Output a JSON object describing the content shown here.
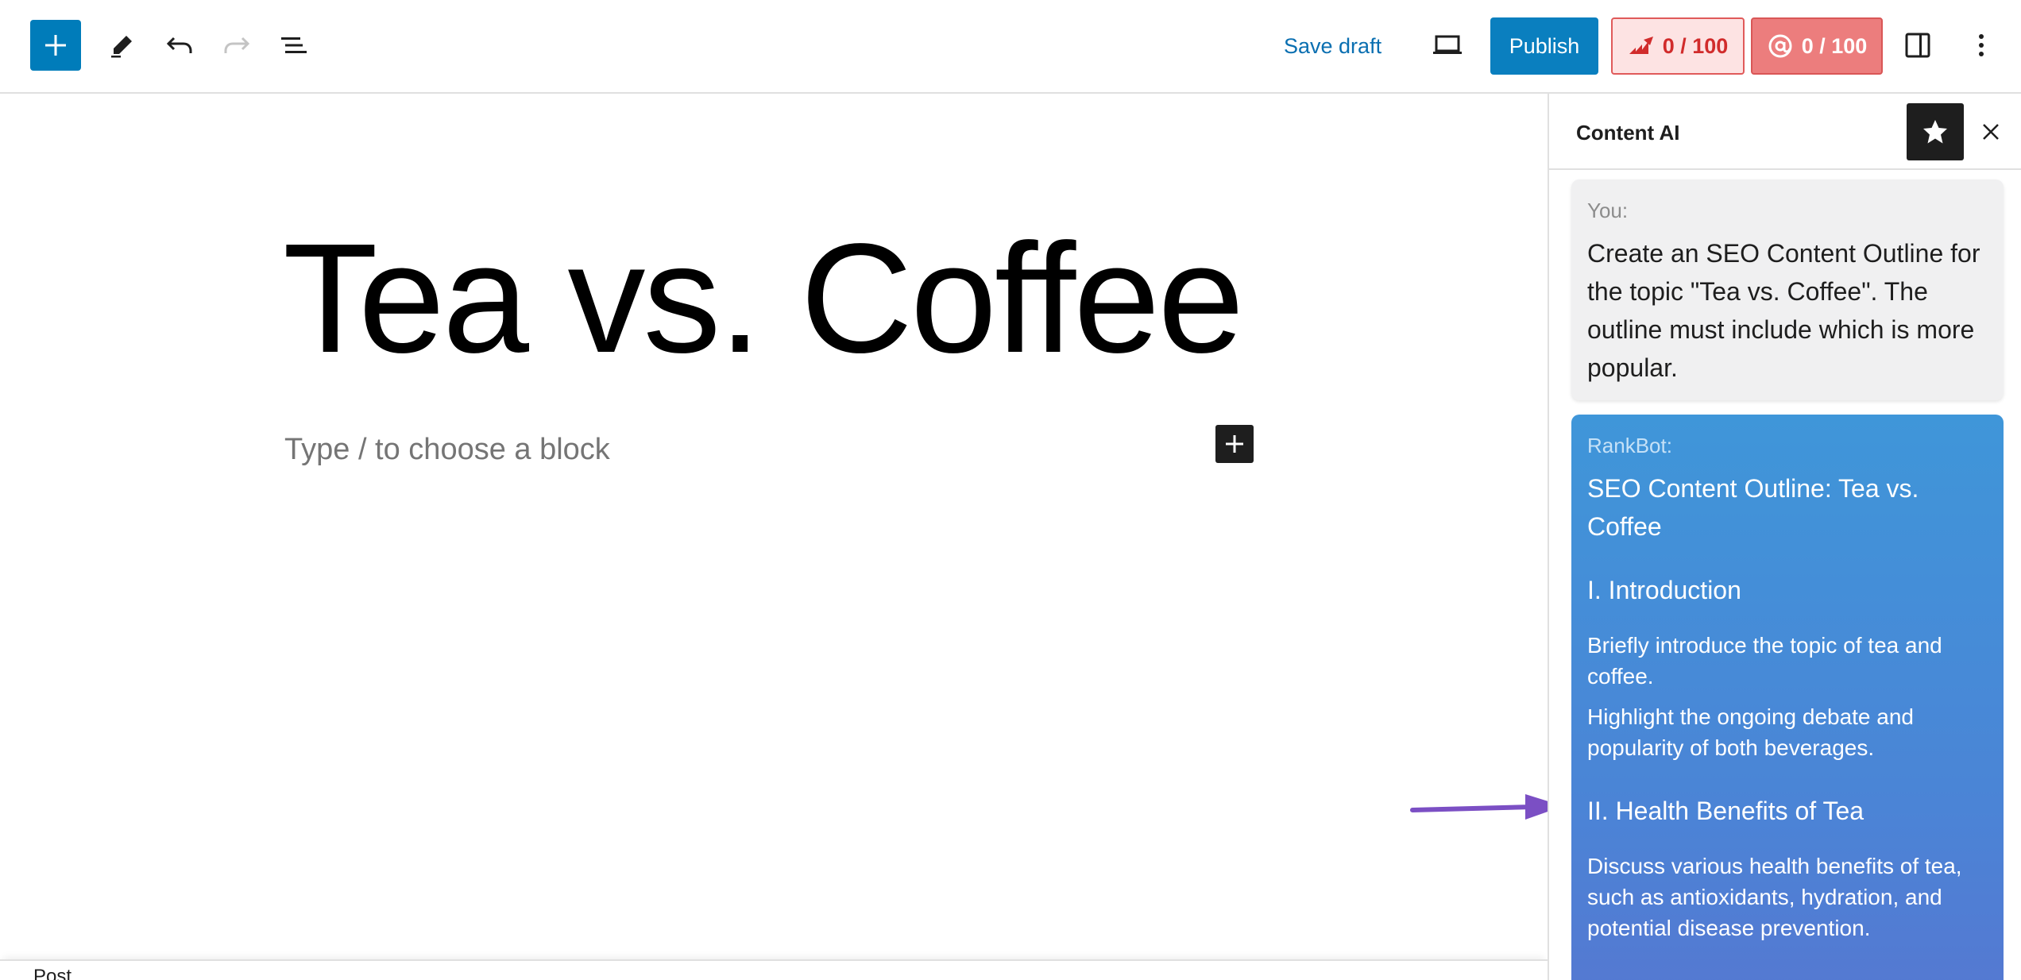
{
  "toolbar": {
    "save_draft": "Save draft",
    "publish": "Publish",
    "seo_score": "0 / 100",
    "content_score": "0 / 100"
  },
  "editor": {
    "title": "Tea vs. Coffee",
    "block_placeholder": "Type / to choose a block"
  },
  "footer": {
    "breadcrumb": "Post"
  },
  "sidebar": {
    "title": "Content AI",
    "user_message": {
      "author": "You:",
      "text": "Create an SEO Content Outline for the topic \"Tea vs. Coffee\". The outline must include which is more popular."
    },
    "bot_message": {
      "author": "RankBot:",
      "heading": "SEO Content Outline: Tea vs. Coffee",
      "section1_title": "I. Introduction",
      "section1_p1": "Briefly introduce the topic of tea and coffee.",
      "section1_p2": "Highlight the ongoing debate and popularity of both beverages.",
      "section2_title": "II. Health Benefits of Tea",
      "section2_p1": "Discuss various health benefits of tea, such as antioxidants, hydration, and potential disease prevention."
    }
  },
  "colors": {
    "wp_blue": "#007cba",
    "publish": "#0a7fbf",
    "seo_badge_bg": "#fde3e3",
    "content_badge_bg": "#ec7d7d",
    "rankbot_gradient_top": "#3f96d9",
    "rankbot_gradient_bottom": "#5677d1",
    "arrow": "#7b4fc4"
  },
  "icons": {
    "inserter": "plus-icon",
    "tools": "pencil-icon",
    "undo": "undo-icon",
    "redo": "redo-icon",
    "document_overview": "list-view-icon",
    "preview": "laptop-icon",
    "seo_score": "rankmath-chart-icon",
    "content_score": "at-sign-icon",
    "settings": "sidebar-toggle-icon",
    "options": "vertical-ellipsis-icon",
    "sidebar_star": "star-icon",
    "sidebar_close": "close-icon"
  }
}
